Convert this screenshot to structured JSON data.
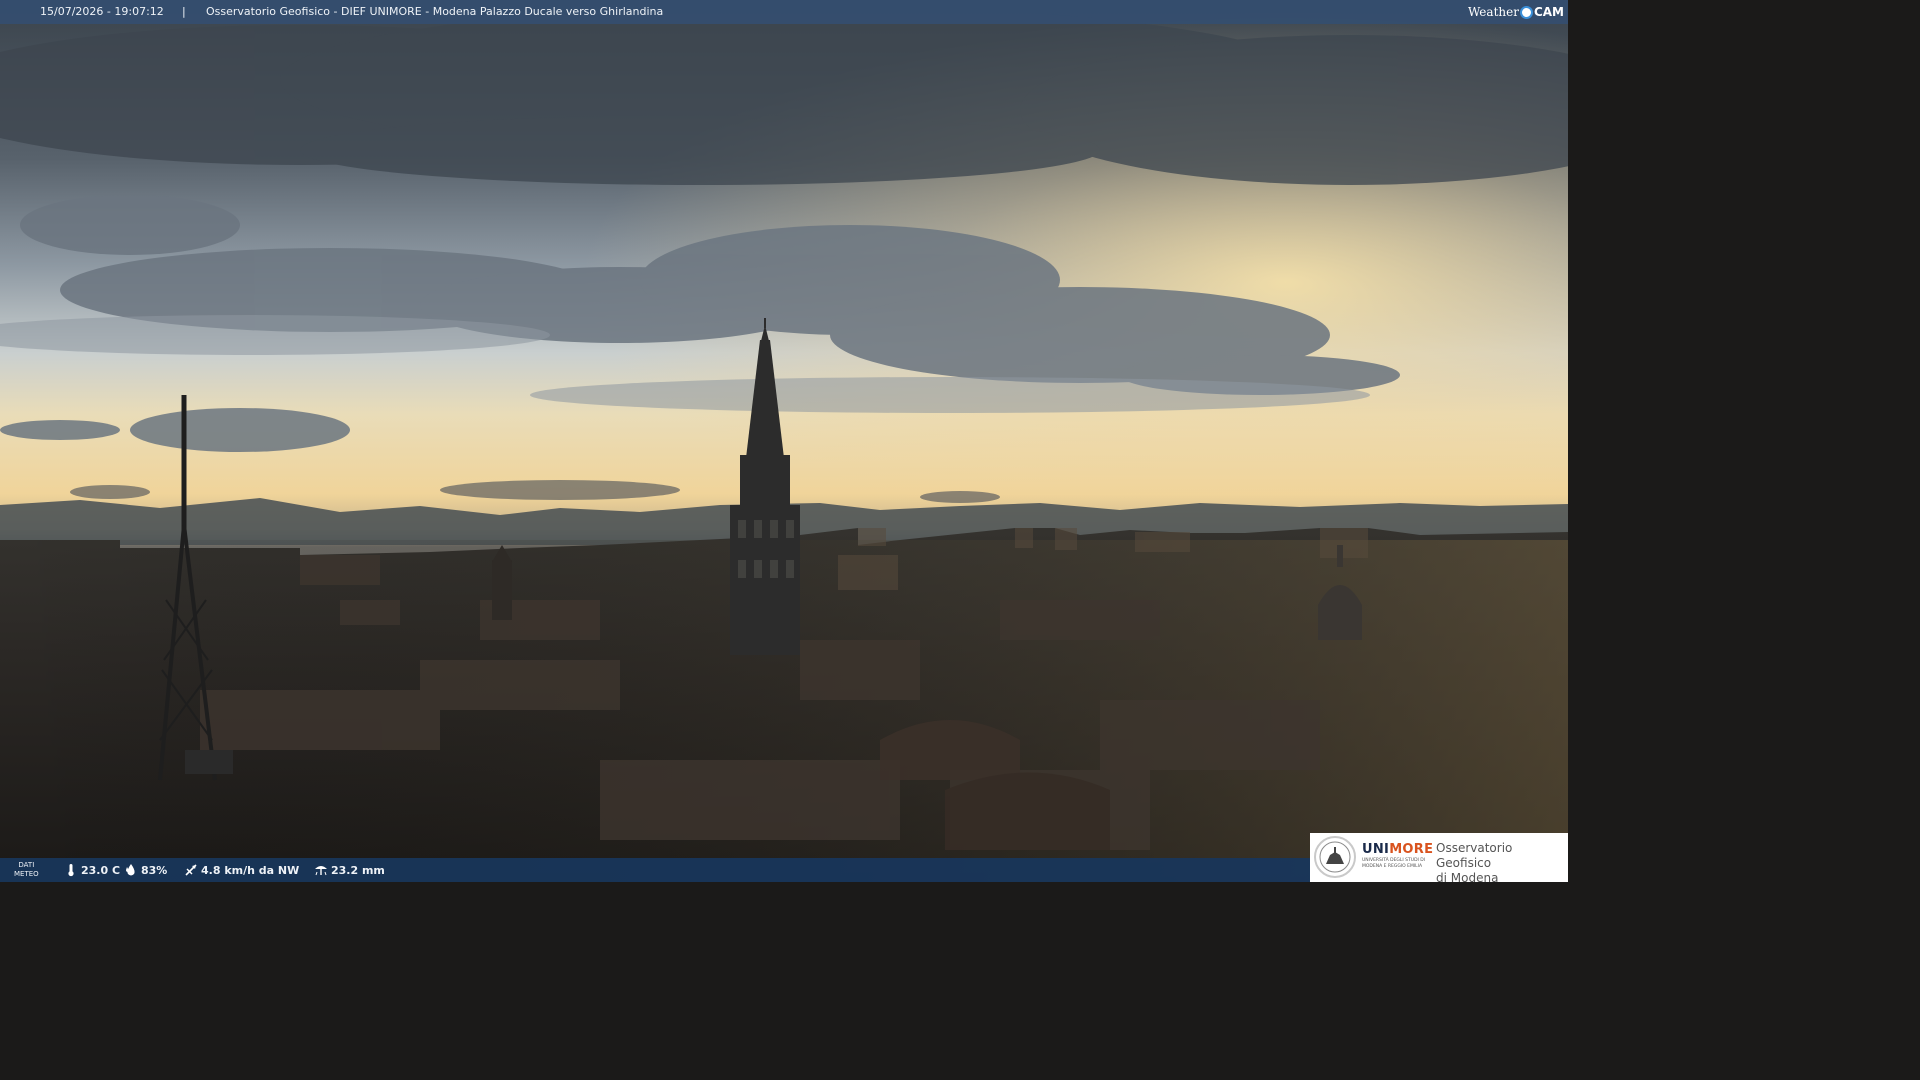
{
  "header": {
    "datetime": "15/07/2026 - 19:07:12",
    "separator": "|",
    "title": "Osservatorio Geofisico - DIEF UNIMORE - Modena Palazzo Ducale verso Ghirlandina",
    "brand_left": "Weather",
    "brand_right": "CAM"
  },
  "meteo": {
    "label_line1": "DATI",
    "label_line2": "METEO",
    "temperature": "23.0 C",
    "humidity": "83%",
    "wind": "4.8 km/h da NW",
    "rain": "23.2 mm",
    "icons": {
      "temperature": "thermometer-icon",
      "humidity": "water-drop-icon",
      "wind": "wind-vane-icon",
      "rain": "rain-gauge-icon"
    }
  },
  "logo": {
    "uni_part1": "UNI",
    "uni_part2": "MORE",
    "uni_sub": "UNIVERSITÀ DEGLI STUDI DI MODENA E REGGIO EMILIA",
    "observatory_line1": "Osservatorio Geofisico",
    "observatory_line2": "di Modena"
  },
  "colors": {
    "top_bar": "#344e70",
    "bottom_bar": "#18365c",
    "unimore_orange": "#d9531e",
    "sky_top": "#3c4650",
    "sky_glow": "#f2dba6"
  }
}
